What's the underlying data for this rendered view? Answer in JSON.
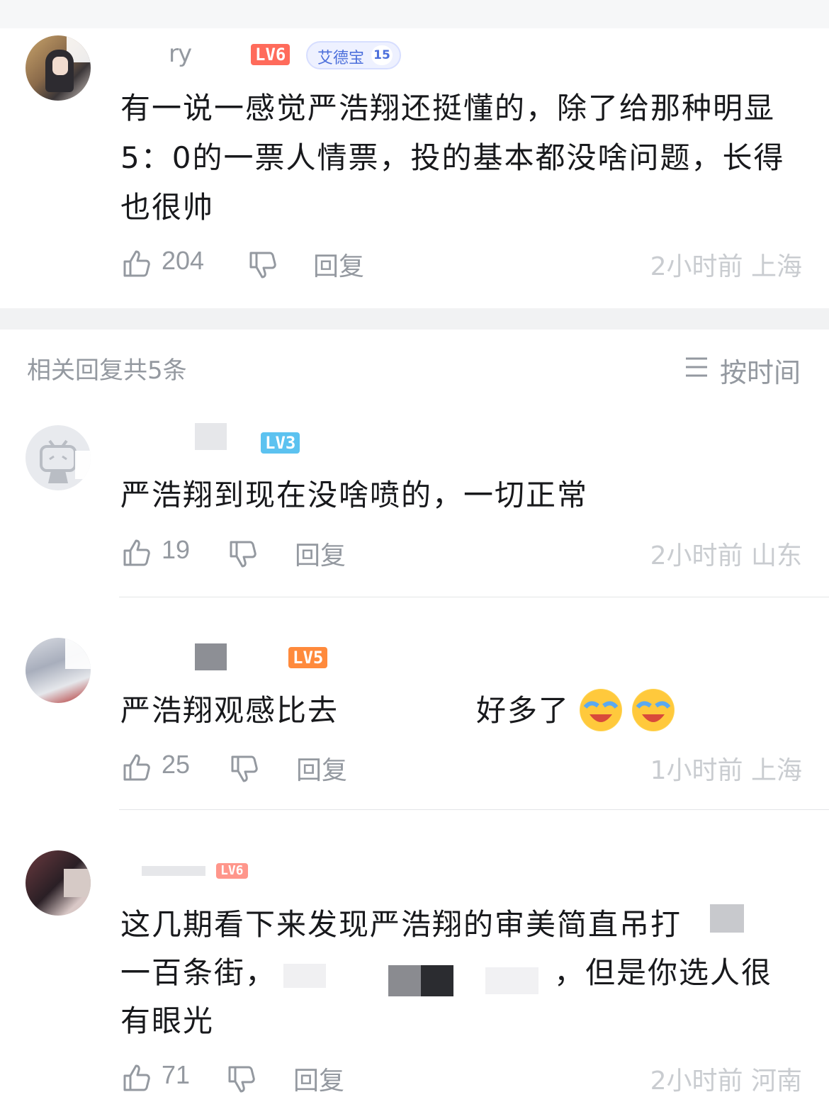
{
  "main_comment": {
    "username": "ry",
    "level": "LV6",
    "medal": {
      "name": "艾德宝",
      "level": "15"
    },
    "text": "有一说一感觉严浩翔还挺懂的，除了给那种明显5：0的一票人情票，投的基本都没啥问题，长得也很帅",
    "likes": "204",
    "reply_label": "回复",
    "meta": "2小时前 上海"
  },
  "related": {
    "label": "相关回复共5条",
    "sort_label": "按时间"
  },
  "replies": [
    {
      "level": "LV3",
      "text": "严浩翔到现在没啥喷的，一切正常",
      "likes": "19",
      "reply_label": "回复",
      "meta": "2小时前 山东"
    },
    {
      "level": "LV5",
      "text_a": "严浩翔观感比去",
      "text_b": "好多了",
      "likes": "25",
      "reply_label": "回复",
      "meta": "1小时前 上海"
    },
    {
      "level": "LV6",
      "text_l1": "这几期看下来发现严浩翔的审美简直吊打",
      "text_l2a": "一百条街，",
      "text_l2b": "，但是你选人很",
      "text_l3": "有眼光",
      "likes": "71",
      "reply_label": "回复",
      "meta": "2小时前 河南"
    }
  ],
  "icons": {
    "like": "thumbs-up-icon",
    "dislike": "thumbs-down-icon",
    "sort": "list-icon",
    "emoji": "laughing-crying-emoji"
  }
}
